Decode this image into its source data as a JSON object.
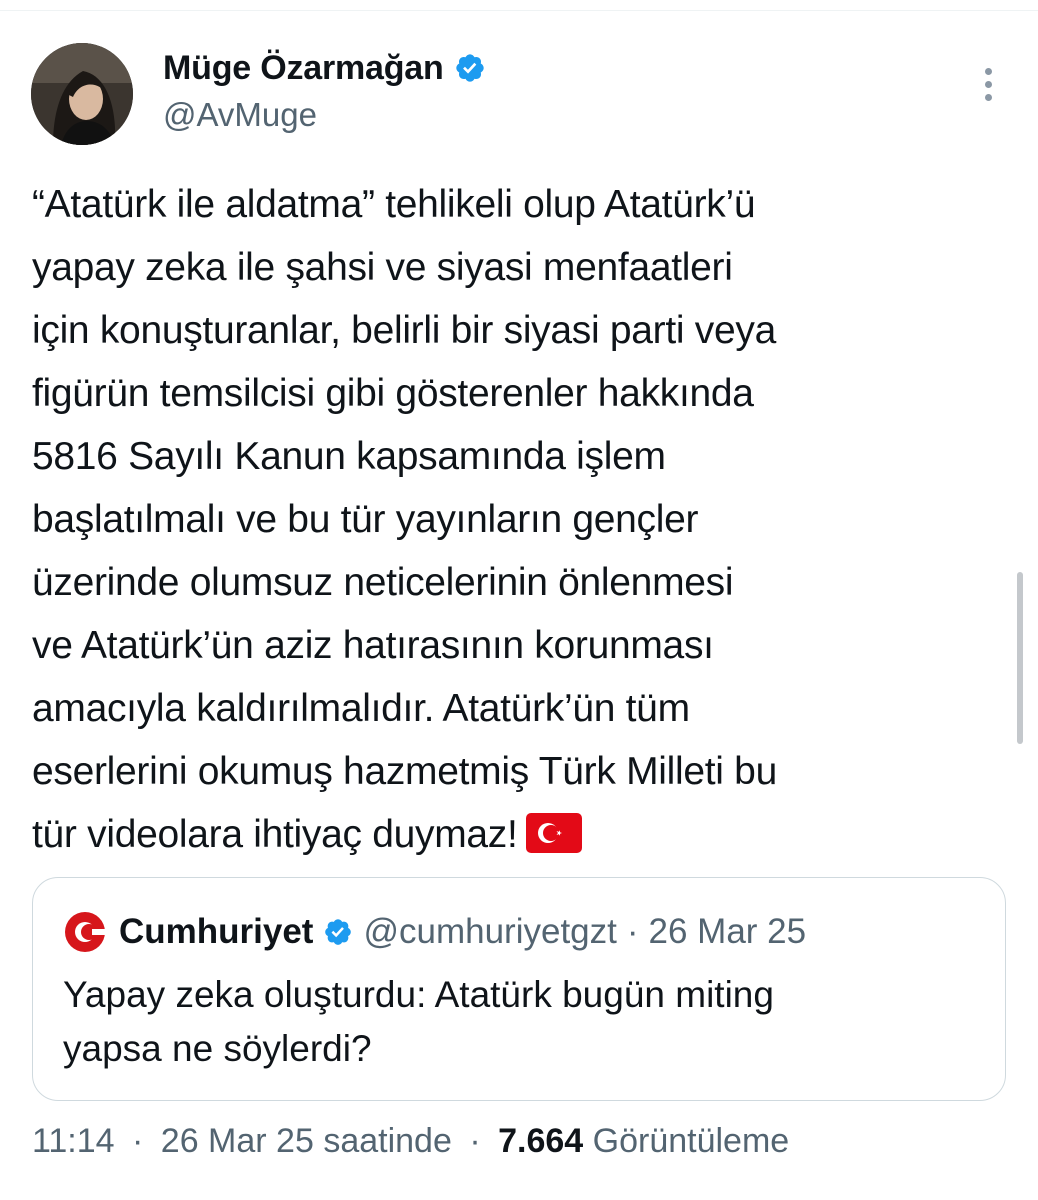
{
  "author": {
    "display_name": "Müge Özarmağan",
    "handle": "@AvMuge",
    "verified": true,
    "verified_color": "#1d9bf0"
  },
  "tweet": {
    "text": "“Atatürk ile aldatma” tehlikeli olup Atatürk’ü\nyapay zeka ile şahsi ve siyasi menfaatleri\niçin konuşturanlar, belirli bir siyasi parti veya\nfigürün temsilcisi gibi gösterenler hakkında\n5816 Sayılı Kanun kapsamında işlem\nbaşlatılmalı ve bu tür yayınların gençler\nüzerinde olumsuz neticelerinin önlenmesi\nve Atatürk’ün aziz hatırasının korunması\namacıyla kaldırılmalıdır. Atatürk’ün tüm\neserlerini okumuş hazmetmiş Türk Milleti bu\ntür videolara ihtiyaç duymaz!",
    "emoji": "turkish-flag-icon"
  },
  "quoted_tweet": {
    "display_name": "Cumhuriyet",
    "handle": "@cumhuriyetgzt",
    "separator": "·",
    "date": "26 Mar 25",
    "verified": true,
    "logo_color": "#d6161b",
    "text": "Yapay zeka oluşturdu: Atatürk bugün miting\nyapsa ne söylerdi?"
  },
  "footer": {
    "time": "11:14",
    "separator": "·",
    "date": "26 Mar 25 saatinde",
    "views_count": "7.664",
    "views_label": "Görüntüleme"
  },
  "colors": {
    "text": "#0f1419",
    "secondary": "#536471",
    "border": "#cfd9de"
  }
}
